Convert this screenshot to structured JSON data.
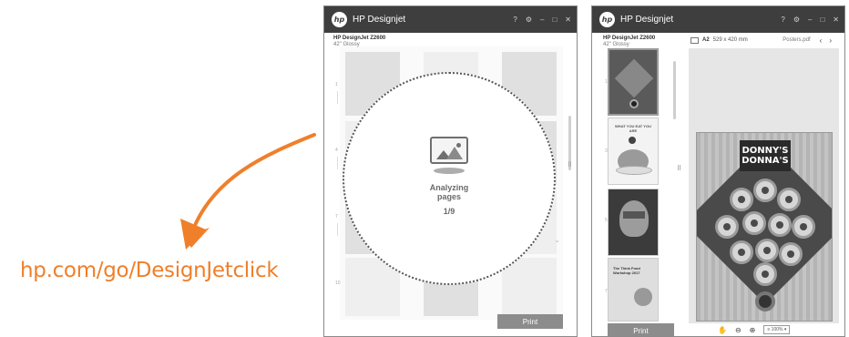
{
  "callout": {
    "url": "hp.com/go/DesignJetclick",
    "color": "#f07f2a"
  },
  "left_window": {
    "title": "HP Designjet",
    "logo_text": "hp",
    "controls": [
      "?",
      "⚙",
      "–",
      "□",
      "✕"
    ],
    "printer_name": "HP DesignJet Z2600",
    "paper": "42\" Glossy",
    "page_numbers": [
      "1",
      "4",
      "7",
      "10"
    ],
    "overlay": {
      "line1": "Analyzing",
      "line2": "pages",
      "count": "1/9"
    },
    "print_button": "Print"
  },
  "right_window": {
    "title": "HP Designjet",
    "logo_text": "hp",
    "controls": [
      "?",
      "⚙",
      "–",
      "□",
      "✕"
    ],
    "printer_name": "HP DesignJet Z2600",
    "paper": "42\" Glossy",
    "page_numbers": [
      "1",
      "3",
      "5",
      "7"
    ],
    "page_size_name": "A2",
    "page_size_dims": "529 x 420 mm",
    "file_name": "Posters.pdf",
    "prev": "‹",
    "next": "›",
    "poster_title": "DONNY'S DONNA'S",
    "thumbnails": [
      {
        "caption": ""
      },
      {
        "caption": "WHAT YOU EAT YOU ARE"
      },
      {
        "caption": ""
      },
      {
        "caption": "The Think Food Workshop 2017"
      }
    ],
    "zoom": "≡ 100%",
    "print_button": "Print"
  }
}
